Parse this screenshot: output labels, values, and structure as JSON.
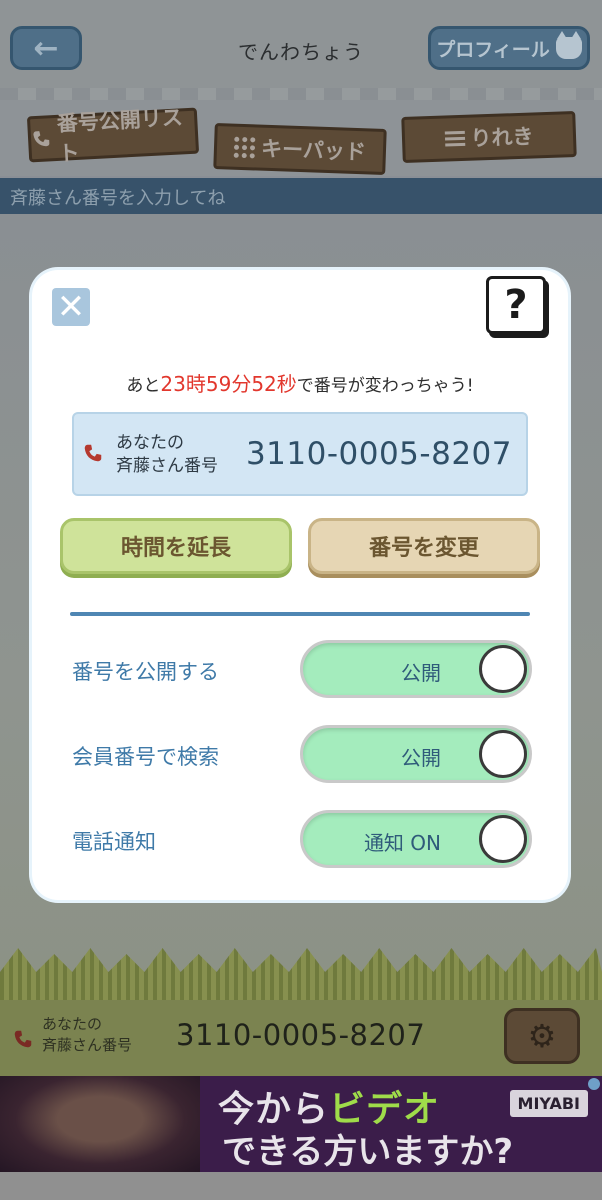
{
  "header": {
    "back_label": "←",
    "title": "でんわちょう",
    "profile_label": "プロフィール"
  },
  "tabs": [
    {
      "label": "番号公開リスト"
    },
    {
      "label": "キーパッド"
    },
    {
      "label": "りれき"
    }
  ],
  "hint": "斉藤さん番号を入力してね",
  "footer": {
    "label_line1": "あなたの",
    "label_line2": "斉藤さん番号",
    "number": "3110-0005-8207"
  },
  "ad": {
    "line1_prefix": "今から",
    "line1_accent": "ビデオ",
    "line2": "できる方いますか?",
    "brand": "MIYABI"
  },
  "modal": {
    "close_label": "✕",
    "help_label": "?",
    "countdown": {
      "prefix": "あと",
      "hours": "23",
      "hours_unit": "時",
      "minutes": "59",
      "minutes_unit": "分",
      "seconds": "52",
      "seconds_unit": "秒",
      "suffix": "で番号が変わっちゃう!"
    },
    "number_label_line1": "あなたの",
    "number_label_line2": "斉藤さん番号",
    "number": "3110-0005-8207",
    "extend_label": "時間を延長",
    "change_label": "番号を変更",
    "settings": [
      {
        "label": "番号を公開する",
        "toggle_text": "公開",
        "on": true
      },
      {
        "label": "会員番号で検索",
        "toggle_text": "公開",
        "on": true
      },
      {
        "label": "電話通知",
        "toggle_text": "通知 ON",
        "on": true
      }
    ]
  },
  "colors": {
    "accent_blue": "#3f7aa8",
    "countdown_red": "#e2372d",
    "toggle_on": "#a4ecbd"
  }
}
